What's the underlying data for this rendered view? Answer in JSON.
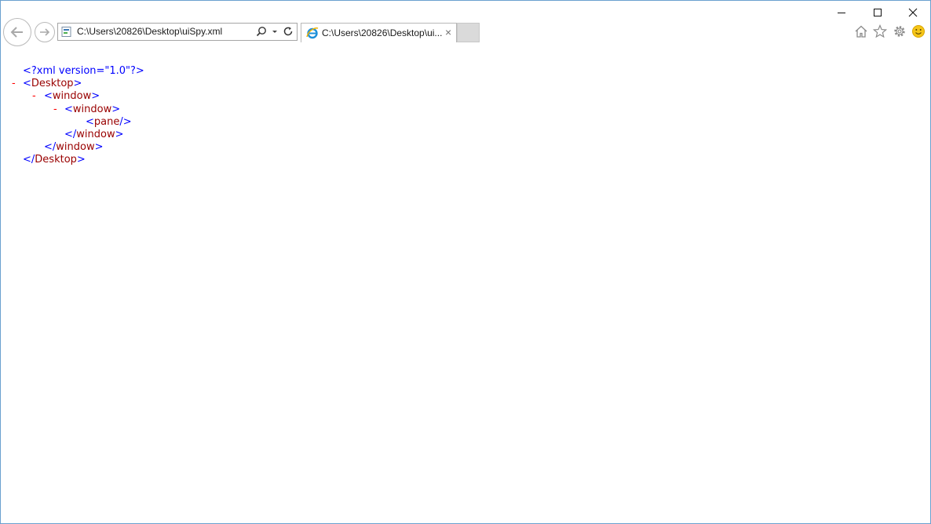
{
  "browser": {
    "address": "C:\\Users\\20826\\Desktop\\uiSpy.xml",
    "tab_title": "C:\\Users\\20826\\Desktop\\ui...",
    "tab_close": "×"
  },
  "xml": {
    "declaration": "<?xml version=\"1.0\"?>",
    "collapse": "-",
    "lt": "<",
    "gt": ">",
    "lt_slash": "</",
    "slash_gt": "/>",
    "desktop": "Desktop",
    "window": "window",
    "pane": "pane"
  },
  "colors": {
    "frame": "#6aa0cf",
    "xml_blue": "#0000ff",
    "xml_tag": "#990000",
    "xml_minus": "#ff0000"
  }
}
